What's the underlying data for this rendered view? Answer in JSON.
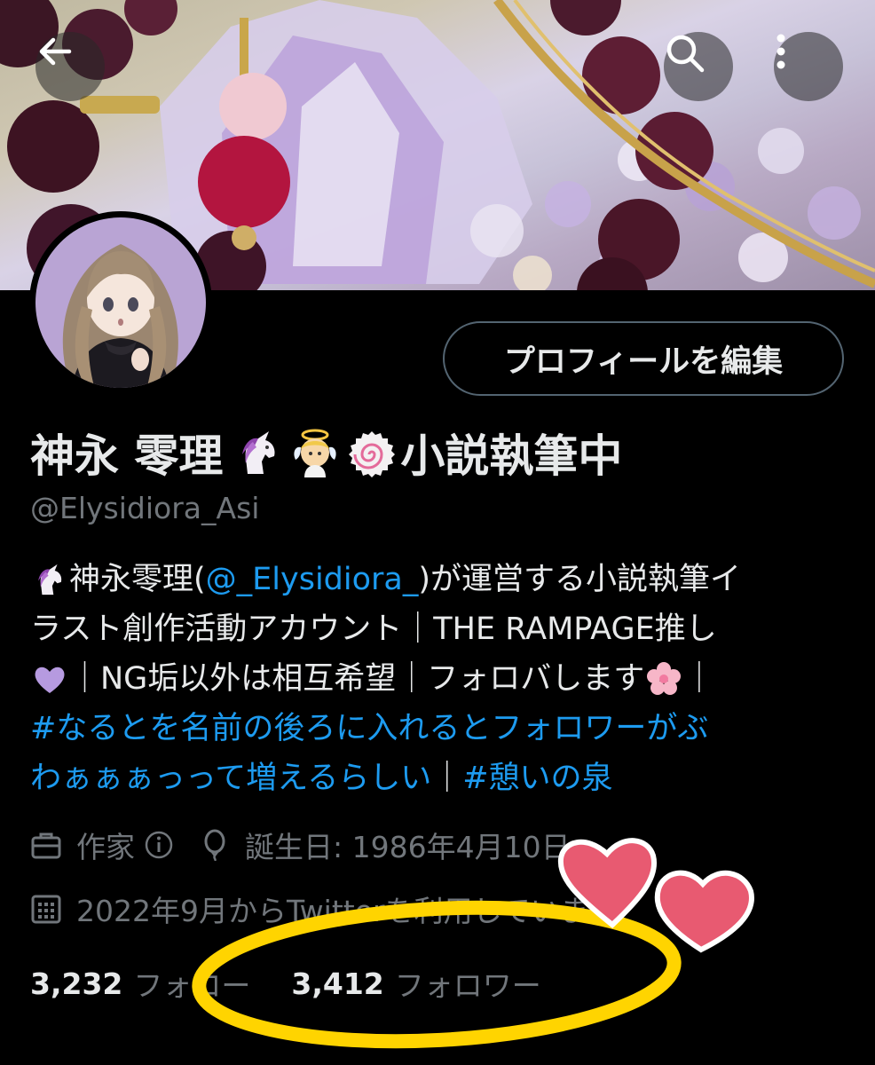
{
  "header": {
    "back_icon": "arrow-left-icon",
    "search_icon": "search-icon",
    "more_icon": "more-vertical-icon"
  },
  "profile": {
    "edit_button_label": "プロフィールを編集",
    "display_name": "神永 零理",
    "display_name_suffix": "小説執筆中",
    "handle": "@Elysidiora_Asi"
  },
  "bio": {
    "line1_a": "神永零理(",
    "line1_link": "@_Elysidiora_",
    "line1_b": ")が運営する小説執筆イ",
    "line2": "ラスト創作活動アカウント｜THE RAMPAGE推し",
    "line3_a": "｜NG垢以外は相互希望｜フォロバします",
    "line3_b": "｜",
    "line4_link": "#なるとを名前の後ろに入れるとフォロワーがぶ",
    "line5_link_a": "わぁぁぁっって増えるらしい",
    "line5_sep": "｜",
    "line5_link_b": "#憩いの泉"
  },
  "meta": {
    "job": "作家",
    "info_icon": "info-icon",
    "birthday": "誕生日: 1986年4月10日",
    "joined": "2022年9月からTwitterを利用しています"
  },
  "stats": {
    "following_count": "3,232",
    "following_label": "フォロー",
    "followers_count": "3,412",
    "followers_label": "フォロワー"
  },
  "colors": {
    "accent": "#1d9bf0",
    "muted": "#71767b",
    "highlight_ring": "#ffd400",
    "heart": "#e85a71"
  }
}
